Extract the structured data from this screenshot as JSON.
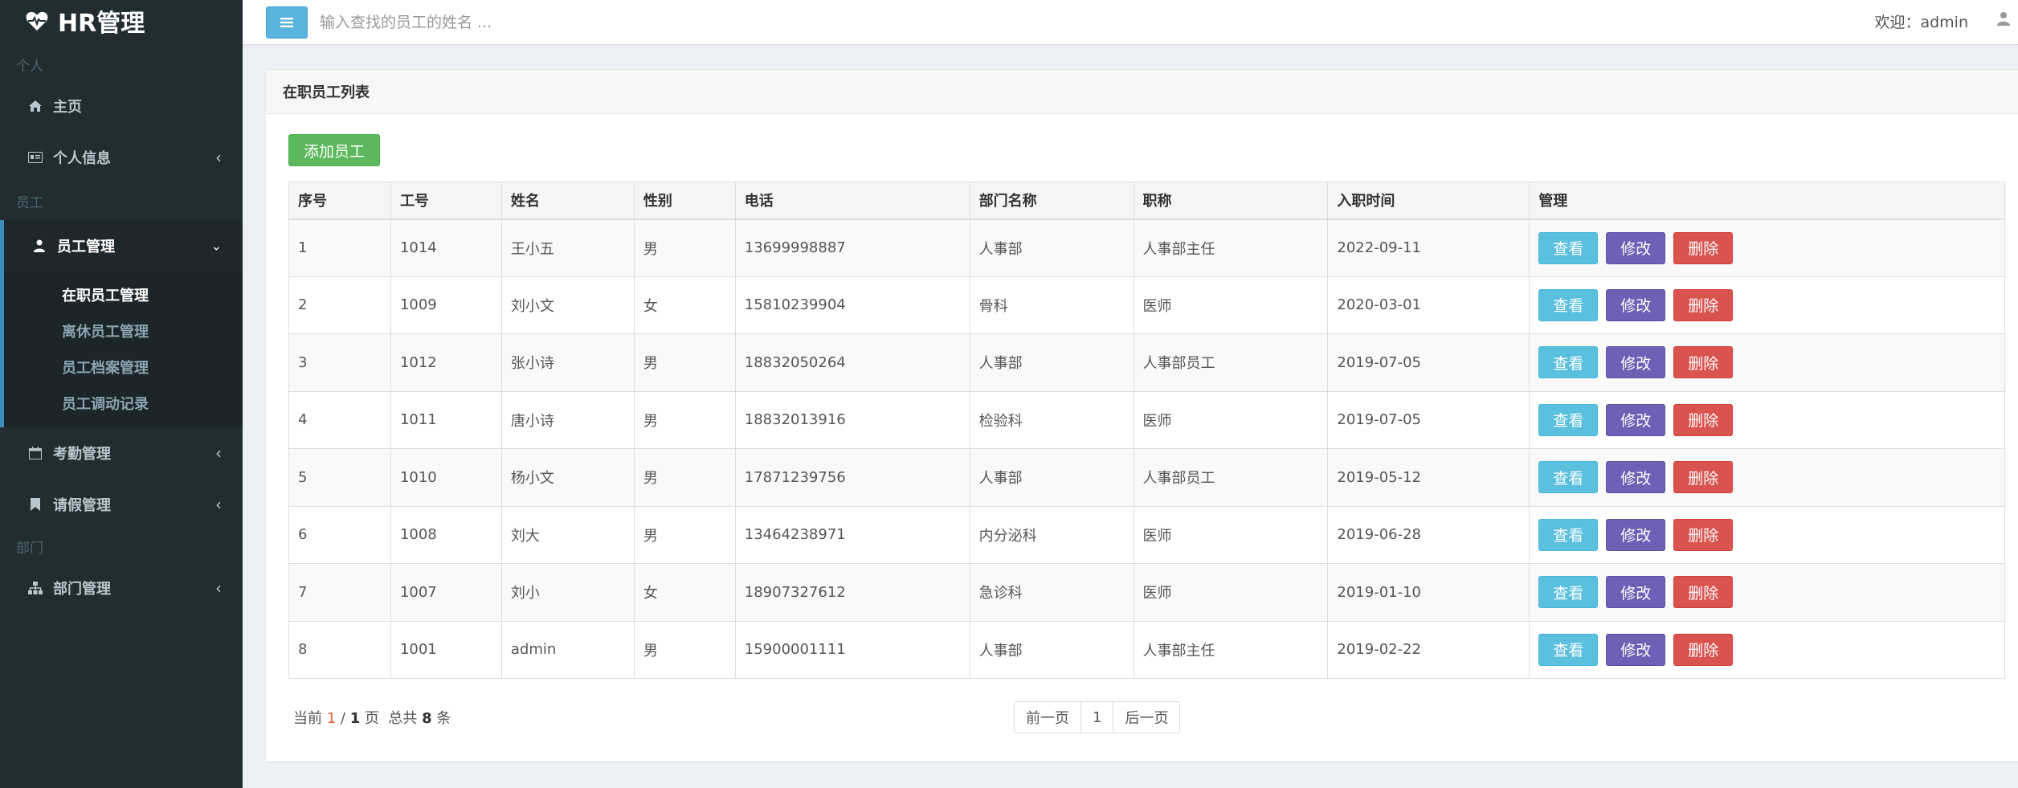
{
  "app": {
    "title": "HR管理"
  },
  "sidebar": {
    "section_personal": "个人",
    "home": "主页",
    "personal_info": "个人信息",
    "section_staff": "员工",
    "staff_mgmt": "员工管理",
    "sub_items": [
      "在职员工管理",
      "离休员工管理",
      "员工档案管理",
      "员工调动记录"
    ],
    "attendance": "考勤管理",
    "leave": "请假管理",
    "section_dept": "部门",
    "dept_mgmt": "部门管理"
  },
  "header": {
    "search_placeholder": "输入查找的员工的姓名 ...",
    "welcome": "欢迎：admin"
  },
  "box": {
    "title": "在职员工列表",
    "add_button": "添加员工"
  },
  "table": {
    "columns": [
      "序号",
      "工号",
      "姓名",
      "性别",
      "电话",
      "部门名称",
      "职称",
      "入职时间",
      "管理"
    ],
    "rows": [
      [
        "1",
        "1014",
        "王小五",
        "男",
        "13699998887",
        "人事部",
        "人事部主任",
        "2022-09-11"
      ],
      [
        "2",
        "1009",
        "刘小文",
        "女",
        "15810239904",
        "骨科",
        "医师",
        "2020-03-01"
      ],
      [
        "3",
        "1012",
        "张小诗",
        "男",
        "18832050264",
        "人事部",
        "人事部员工",
        "2019-07-05"
      ],
      [
        "4",
        "1011",
        "唐小诗",
        "男",
        "18832013916",
        "检验科",
        "医师",
        "2019-07-05"
      ],
      [
        "5",
        "1010",
        "杨小文",
        "男",
        "17871239756",
        "人事部",
        "人事部员工",
        "2019-05-12"
      ],
      [
        "6",
        "1008",
        "刘大",
        "男",
        "13464238971",
        "内分泌科",
        "医师",
        "2019-06-28"
      ],
      [
        "7",
        "1007",
        "刘小",
        "女",
        "18907327612",
        "急诊科",
        "医师",
        "2019-01-10"
      ],
      [
        "8",
        "1001",
        "admin",
        "男",
        "15900001111",
        "人事部",
        "人事部主任",
        "2019-02-22"
      ]
    ],
    "actions": {
      "view": "查看",
      "edit": "修改",
      "delete": "删除"
    }
  },
  "pagination": {
    "current_prefix": "当前",
    "current_page": "1",
    "separator": " / ",
    "total_pages": "1",
    "page_suffix": "页",
    "total_prefix": "总共",
    "total_count": "8",
    "count_suffix": "条",
    "prev": "前一页",
    "page_num": "1",
    "next": "后一页"
  },
  "colors": {
    "sidebar_bg": "#222d32",
    "accent": "#3c8dbc",
    "add_green": "#5cb85c",
    "view_blue": "#5bc0de",
    "edit_purple": "#6f5fb5",
    "delete_red": "#d9534f"
  }
}
